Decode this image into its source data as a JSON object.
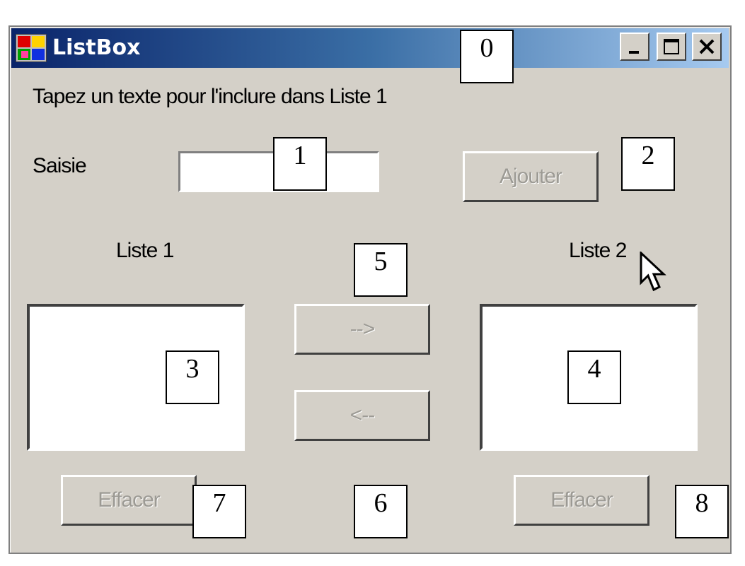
{
  "window": {
    "title": "ListBox",
    "controls": {
      "minimize": "_",
      "maximize": "□",
      "close": "X"
    }
  },
  "form": {
    "instruction": "Tapez un texte pour l'inclure dans Liste 1",
    "saisie_label": "Saisie",
    "saisie_value": "",
    "add_button": "Ajouter",
    "list1_label": "Liste 1",
    "list2_label": "Liste 2",
    "move_right_button": "-->",
    "move_left_button": "<--",
    "clear1_button": "Effacer",
    "clear2_button": "Effacer",
    "list1_items": [],
    "list2_items": []
  },
  "callouts": [
    "0",
    "1",
    "2",
    "3",
    "4",
    "5",
    "6",
    "7",
    "8"
  ],
  "colors": {
    "face": "#d4d0c8",
    "title_start": "#0a246a",
    "title_end": "#a6caf0",
    "disabled_text": "#9c9a94"
  },
  "icons": [
    "app-icon",
    "minimize-icon",
    "maximize-icon",
    "close-icon",
    "cursor-arrow-icon"
  ]
}
